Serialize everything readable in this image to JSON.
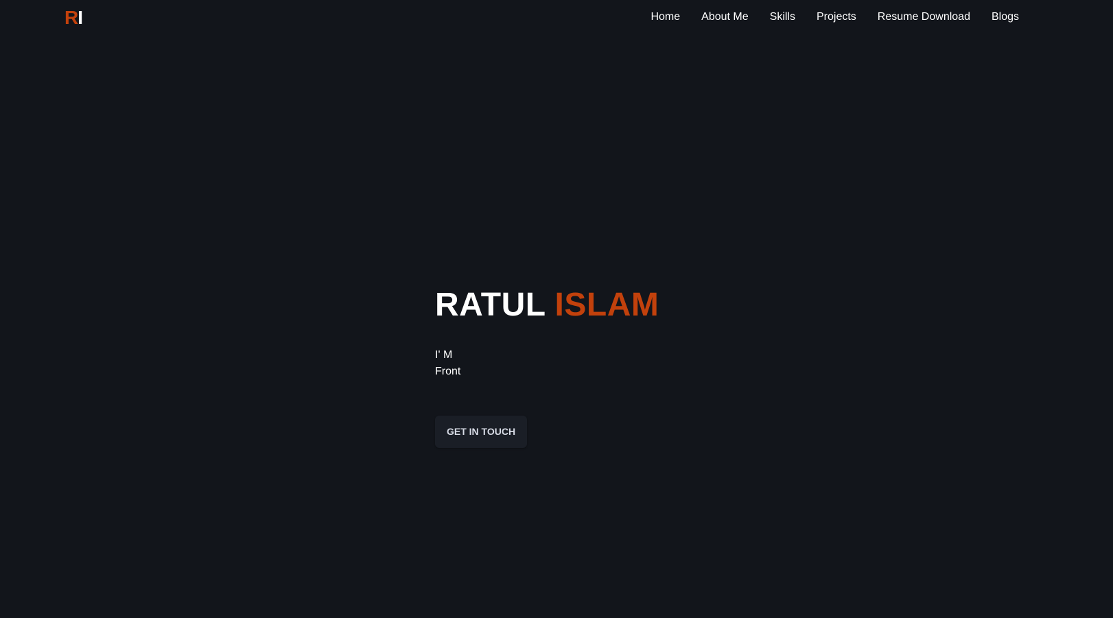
{
  "navbar": {
    "logo": {
      "first_letter": "R",
      "second_letter": "I"
    },
    "links": [
      "Home",
      "About Me",
      "Skills",
      "Projects",
      "Resume Download",
      "Blogs"
    ]
  },
  "hero": {
    "first_name": "RATUL",
    "last_name": "ISLAM",
    "intro_line_1": "I' M",
    "intro_line_2": "Front",
    "cta_label": "GET IN TOUCH"
  },
  "colors": {
    "background": "#12151b",
    "accent": "#c2410c",
    "text": "#ffffff",
    "button_bg": "#1a1e26"
  }
}
